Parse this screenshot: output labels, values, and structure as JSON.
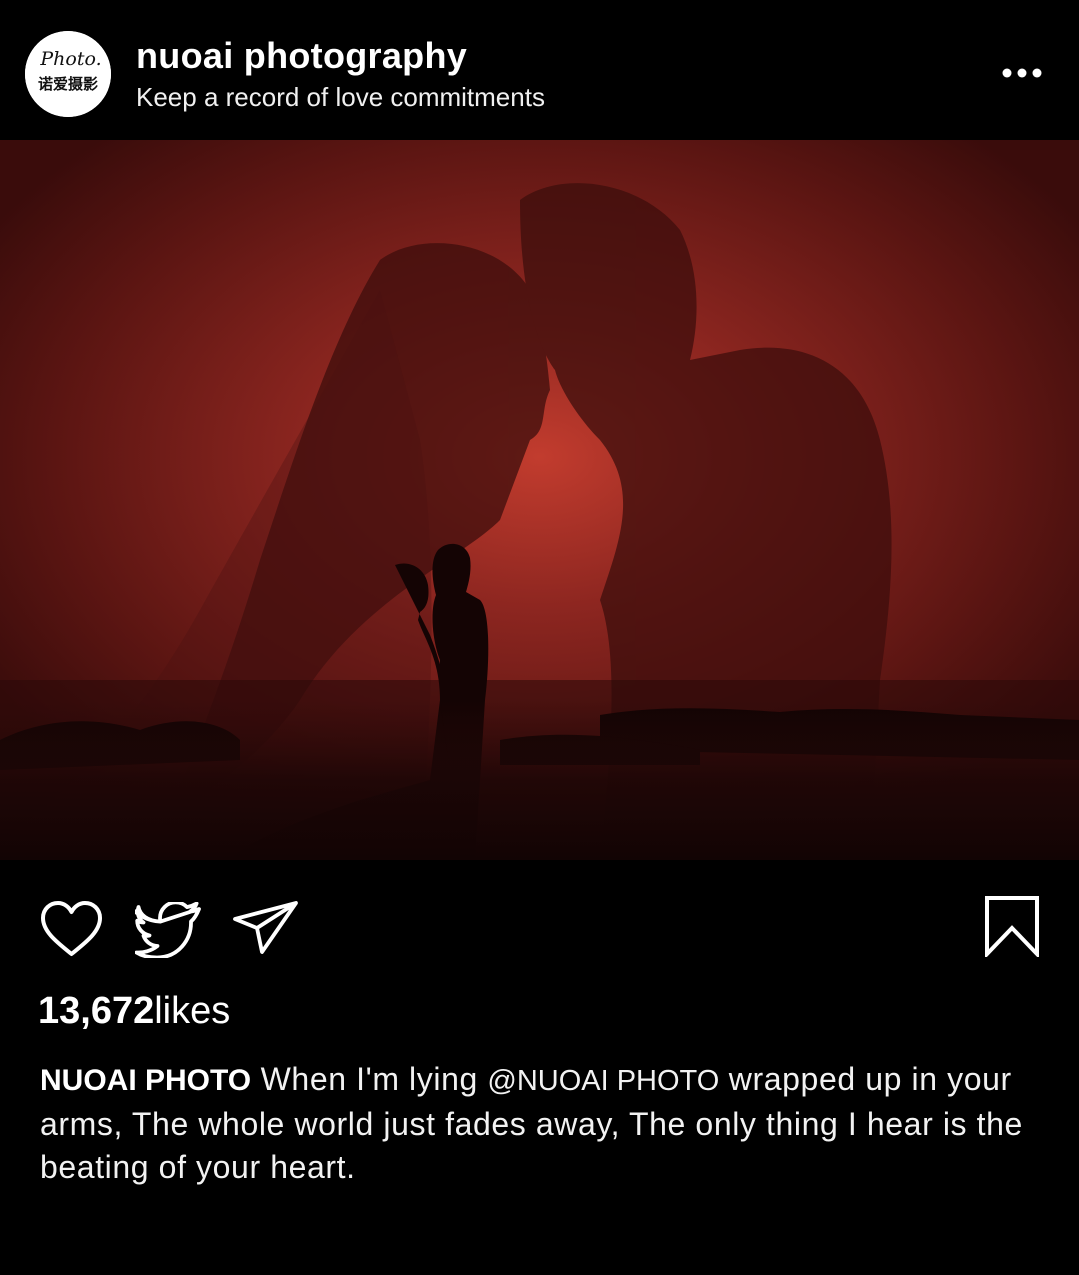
{
  "header": {
    "account_name": "nuoai photography",
    "account_subtitle": "Keep a record of love commitments",
    "avatar": {
      "logo_script": "Photo.",
      "logo_text": "诺爱摄影"
    },
    "more_icon": "more-horizontal-icon"
  },
  "post": {
    "image_description_icon": "photo",
    "actions": {
      "like_icon": "heart-icon",
      "share_icon": "twitter-bird-icon",
      "send_icon": "paper-plane-icon",
      "save_icon": "bookmark-icon"
    },
    "likes_count": "13,672",
    "likes_suffix": "likes",
    "caption": {
      "username": "NUOAI PHOTO",
      "text_before_mention": " When I'm lying ",
      "mention": "@NUOAI PHOTO",
      "text_after_mention": " wrapped up in your arms, The whole world just fades away, The only thing I hear is the beating of your heart."
    }
  },
  "colors": {
    "background": "#000000",
    "text": "#ffffff",
    "photo_tint": "#7a1c18"
  }
}
